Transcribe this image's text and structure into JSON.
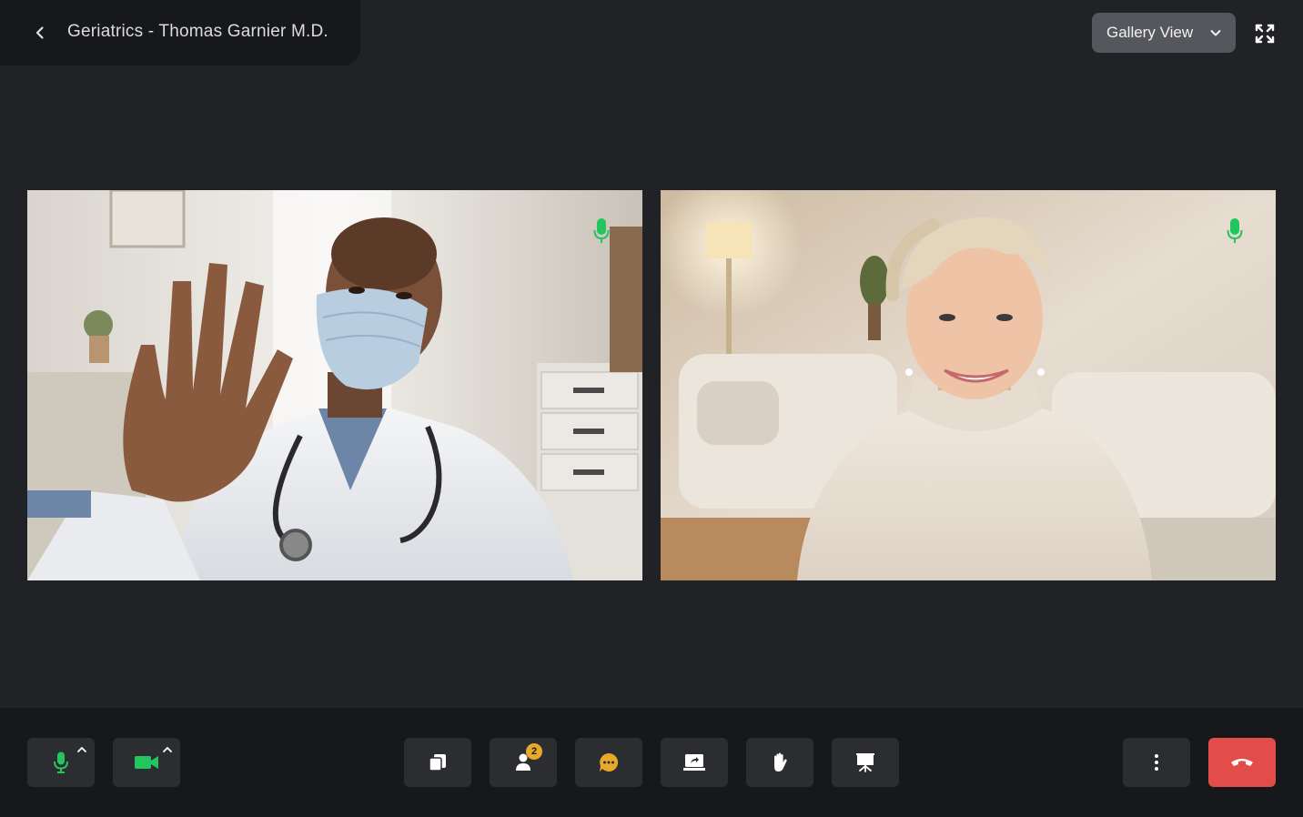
{
  "header": {
    "title": "Geriatrics - Thomas Garnier M.D.",
    "back_icon": "chevron-left-icon"
  },
  "view_select": {
    "label": "Gallery View",
    "icon": "chevron-down-icon"
  },
  "fullscreen": {
    "icon": "expand-icon"
  },
  "participants": [
    {
      "role": "doctor",
      "active_speaker": true,
      "mic": "on"
    },
    {
      "role": "patient",
      "active_speaker": false,
      "mic": "on"
    }
  ],
  "toolbar": {
    "left": [
      {
        "name": "mic",
        "icon": "microphone-icon",
        "color": "#22c55e"
      },
      {
        "name": "camera",
        "icon": "video-camera-icon",
        "color": "#22c55e"
      }
    ],
    "center": [
      {
        "name": "documents",
        "icon": "documents-icon"
      },
      {
        "name": "participants",
        "icon": "user-icon",
        "badge": "2"
      },
      {
        "name": "chat",
        "icon": "chat-bubble-icon",
        "color": "#e8a92b"
      },
      {
        "name": "share-screen",
        "icon": "share-screen-icon"
      },
      {
        "name": "raise-hand",
        "icon": "hand-icon"
      },
      {
        "name": "presentation",
        "icon": "presentation-icon"
      }
    ],
    "right": [
      {
        "name": "more",
        "icon": "more-vertical-icon"
      },
      {
        "name": "end-call",
        "icon": "phone-hangup-icon",
        "color": "#e24d49"
      }
    ]
  },
  "colors": {
    "background": "#212226",
    "bar": "#17181b",
    "button": "#2c2d31",
    "active": "#22c55e",
    "end_call": "#e24d49",
    "badge": "#e8a92b"
  }
}
